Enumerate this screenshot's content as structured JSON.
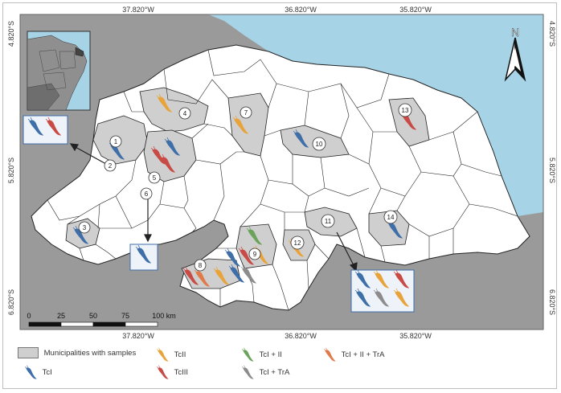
{
  "coordinates": {
    "top": [
      "37.820°W",
      "36.820°W",
      "35.820°W"
    ],
    "bottom": [
      "37.820°W",
      "36.820°W",
      "35.820°W"
    ],
    "left": [
      "4.820°S",
      "5.820°S",
      "6.820°S"
    ],
    "right": [
      "4.820°S",
      "5.820°S",
      "6.820°S"
    ]
  },
  "north_arrow": {
    "label": "N",
    "icon": "north-arrow-icon"
  },
  "scale_bar": {
    "ticks": [
      "0",
      "25",
      "50",
      "75",
      "100 km"
    ]
  },
  "municipality_numbers": [
    "1",
    "2",
    "3",
    "4",
    "5",
    "6",
    "7",
    "8",
    "9",
    "10",
    "11",
    "12",
    "13",
    "14"
  ],
  "legend": {
    "municipalities_label": "Municipalities with samples",
    "items": [
      {
        "label": "TcI",
        "color": "#3f6fa8",
        "icon": "insect-icon"
      },
      {
        "label": "TcII",
        "color": "#e8a33a",
        "icon": "insect-icon"
      },
      {
        "label": "TcIII",
        "color": "#c94b45",
        "icon": "insect-icon"
      },
      {
        "label": "TcI + II",
        "color": "#6aa35a",
        "icon": "insect-icon"
      },
      {
        "label": "TcI + TrA",
        "color": "#8c8c8c",
        "icon": "insect-icon"
      },
      {
        "label": "TcI + II + TrA",
        "color": "#e07a4a",
        "icon": "insect-icon"
      }
    ]
  },
  "colors": {
    "ocean": "#a7d3e6",
    "surrounding": "#9a9a9a",
    "municipality": "#ffffff",
    "sampled": "#cfcfcf"
  }
}
